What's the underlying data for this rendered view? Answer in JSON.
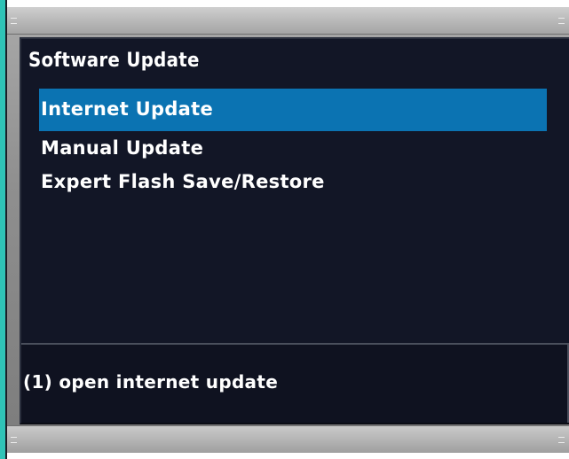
{
  "window": {
    "title": "Software Update"
  },
  "menu": {
    "items": [
      {
        "label": "Internet Update",
        "selected": true
      },
      {
        "label": "Manual Update",
        "selected": false
      },
      {
        "label": "Expert Flash Save/Restore",
        "selected": false
      }
    ]
  },
  "help": {
    "text": "(1) open internet update"
  },
  "colors": {
    "accent": "#2fc3b7",
    "selection": "#0b73b2",
    "background": "#121626",
    "text": "#ffffff"
  }
}
